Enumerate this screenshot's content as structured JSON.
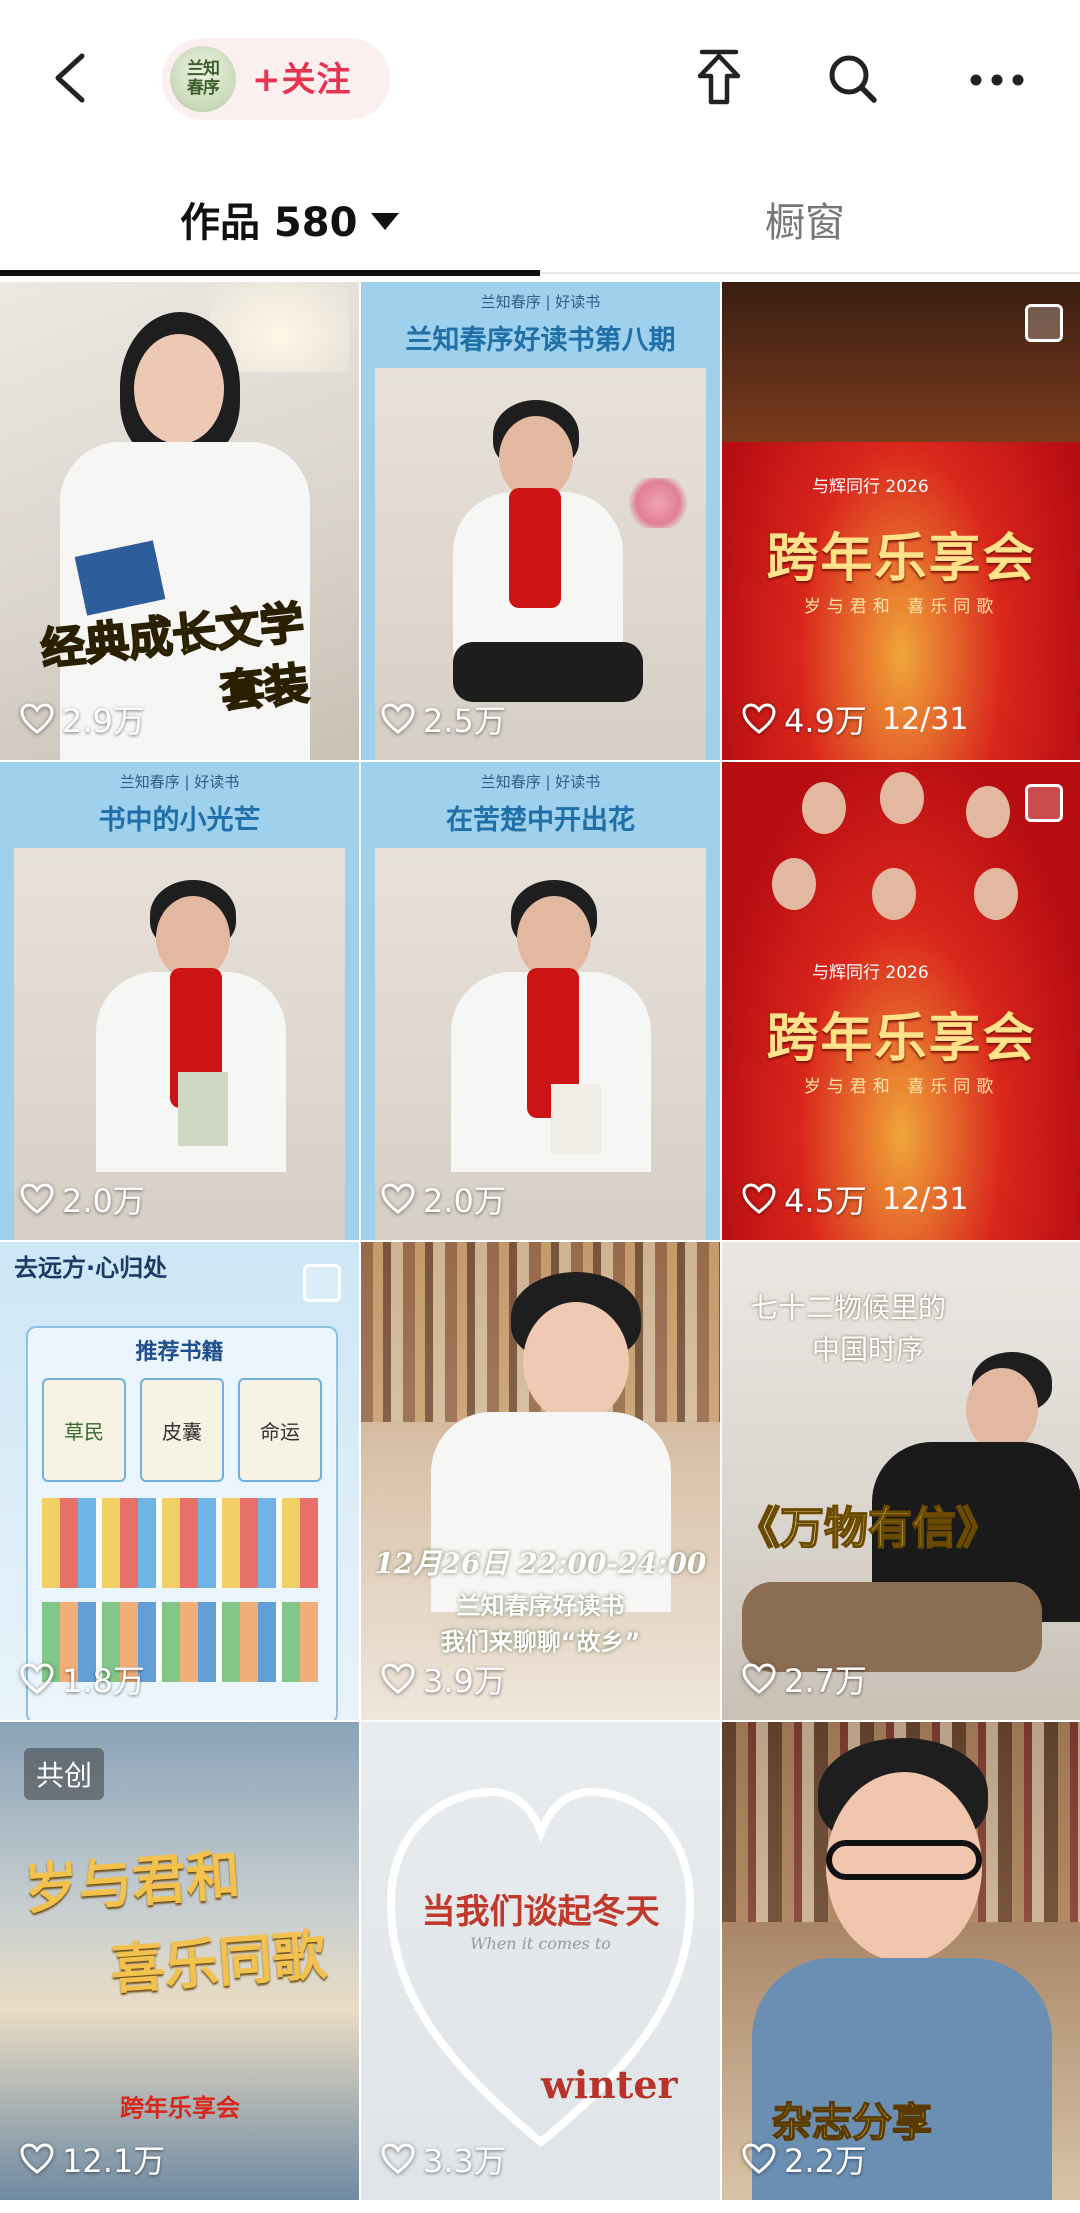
{
  "header": {
    "avatar_text": "兰知春序",
    "follow_label": "+关注",
    "icons": [
      "back-icon",
      "share-icon",
      "search-icon",
      "more-icon"
    ]
  },
  "tabs": {
    "works_label": "作品 580",
    "window_label": "橱窗"
  },
  "videos": [
    {
      "likes": "2.9万",
      "caption": "经典成长文学",
      "caption2": "套装"
    },
    {
      "likes": "2.5万",
      "top": "兰知春序 | 好读书",
      "title": "兰知春序好读书第八期"
    },
    {
      "likes": "4.9万",
      "tag": "与辉同行 2026",
      "title": "跨年乐享会",
      "sub": "岁与君和 喜乐同歌",
      "date": "12/31"
    },
    {
      "likes": "2.0万",
      "top": "兰知春序 | 好读书",
      "title": "书中的小光芒"
    },
    {
      "likes": "2.0万",
      "top": "兰知春序 | 好读书",
      "title": "在苦楚中开出花"
    },
    {
      "likes": "4.5万",
      "tag": "与辉同行 2026",
      "title": "跨年乐享会",
      "sub": "岁与君和 喜乐同歌",
      "date": "12/31"
    },
    {
      "likes": "1.8万",
      "top": "去远方·心归处",
      "title": "推荐书籍",
      "books": [
        "草民",
        "皮囊",
        "命运"
      ]
    },
    {
      "likes": "3.9万",
      "line1": "12月26日 22:00-24:00",
      "line2": "兰知春序好读书",
      "line3": "我们来聊聊“故乡”"
    },
    {
      "likes": "2.7万",
      "line1": "七十二物候里的",
      "line2": "中国时序",
      "line3": "《万物有信》"
    },
    {
      "likes": "12.1万",
      "badge": "共创",
      "line1": "岁与君和",
      "line2": "喜乐同歌",
      "line3": "跨年乐享会"
    },
    {
      "likes": "3.3万",
      "line1": "当我们谈起冬天",
      "line2": "When it comes to",
      "line3": "winter"
    },
    {
      "likes": "2.2万",
      "line1": "杂志分享"
    }
  ],
  "colors": {
    "follow": "#e8324f",
    "accent_blue": "#1f6fa8",
    "festival_red": "#c8161b"
  }
}
